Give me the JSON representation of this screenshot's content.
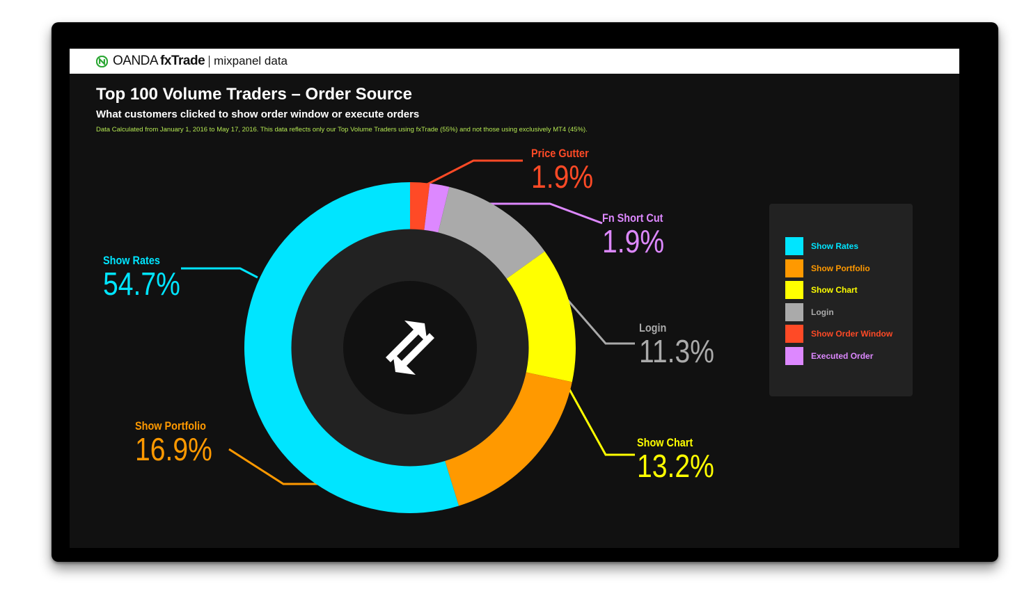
{
  "header": {
    "brand_oanda": "OANDA",
    "brand_fxtrade": "fxTrade",
    "brand_source": "mixpanel data"
  },
  "title": "Top 100 Volume Traders – Order Source",
  "subtitle": "What customers clicked to show order window or execute orders",
  "note": "Data Calculated from January 1, 2016 to May 17, 2016. This data reflects only our Top Volume Traders using fxTrade (55%) and not those using exclusively MT4 (45%).",
  "colors": {
    "show_rates": "#00e5ff",
    "show_portfolio": "#ff9900",
    "show_chart": "#ffff00",
    "login": "#aaaaaa",
    "show_order_window": "#ff4a26",
    "executed_order": "#dd88ff",
    "background": "#111111",
    "green_note": "#b5e853"
  },
  "center_icon": "swap-arrows-icon",
  "callouts": [
    {
      "key": "price_gutter",
      "label": "Price Gutter",
      "value": "1.9%",
      "color": "#ff4a26"
    },
    {
      "key": "fn_short_cut",
      "label": "Fn Short Cut",
      "value": "1.9%",
      "color": "#dd88ff"
    },
    {
      "key": "login",
      "label": "Login",
      "value": "11.3%",
      "color": "#aaaaaa"
    },
    {
      "key": "show_chart",
      "label": "Show Chart",
      "value": "13.2%",
      "color": "#ffff00"
    },
    {
      "key": "show_portfolio",
      "label": "Show Portfolio",
      "value": "16.9%",
      "color": "#ff9900"
    },
    {
      "key": "show_rates",
      "label": "Show Rates",
      "value": "54.7%",
      "color": "#00e5ff"
    }
  ],
  "legend": [
    {
      "label": "Show Rates",
      "color": "#00e5ff"
    },
    {
      "label": "Show Portfolio",
      "color": "#ff9900"
    },
    {
      "label": "Show Chart",
      "color": "#ffff00"
    },
    {
      "label": "Login",
      "color": "#aaaaaa"
    },
    {
      "label": "Show Order Window",
      "color": "#ff4a26"
    },
    {
      "label": "Executed Order",
      "color": "#dd88ff"
    }
  ],
  "chart_data": {
    "type": "pie",
    "variant": "donut",
    "title": "Top 100 Volume Traders – Order Source",
    "slices": [
      {
        "name": "Price Gutter",
        "value": 1.9,
        "color": "#ff4a26"
      },
      {
        "name": "Fn Short Cut",
        "value": 1.9,
        "color": "#dd88ff"
      },
      {
        "name": "Login",
        "value": 11.3,
        "color": "#aaaaaa"
      },
      {
        "name": "Show Chart",
        "value": 13.2,
        "color": "#ffff00"
      },
      {
        "name": "Show Portfolio",
        "value": 16.9,
        "color": "#ff9900"
      },
      {
        "name": "Show Rates",
        "value": 54.7,
        "color": "#00e5ff"
      }
    ],
    "legend_position": "right"
  }
}
